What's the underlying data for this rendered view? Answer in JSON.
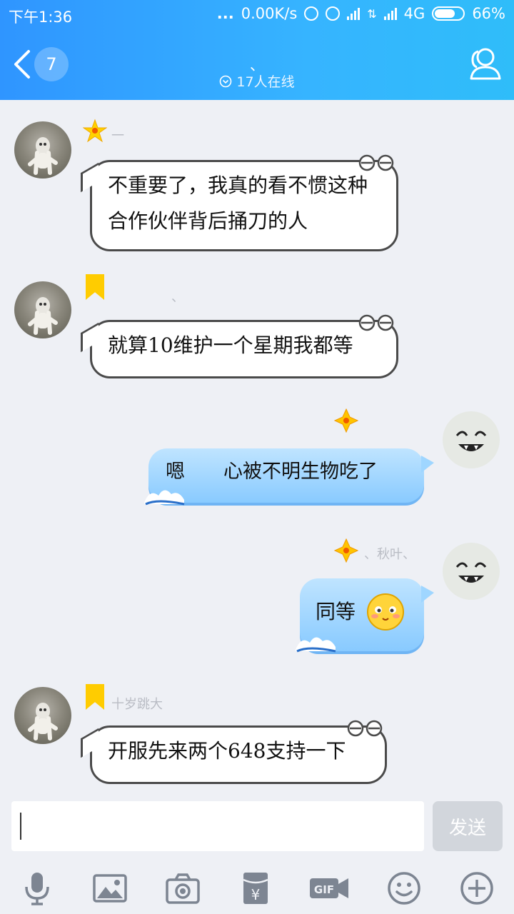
{
  "status_bar": {
    "time": "下午1:36",
    "dots": "...",
    "speed": "0.00K/s",
    "network": "4G",
    "battery": "66%"
  },
  "header": {
    "back_badge": "7",
    "title": "、",
    "online": "17人在线"
  },
  "messages": [
    {
      "side": "left",
      "name": "一",
      "text": "不重要了，我真的看不惯这种合作伙伴背后捅刀的人"
    },
    {
      "side": "left",
      "name": "、",
      "text": "就算10维护一个星期我都等"
    },
    {
      "side": "right",
      "name": "",
      "text": "嗯　　心被不明生物吃了"
    },
    {
      "side": "right",
      "name": "、秋叶、",
      "text": "同等"
    },
    {
      "side": "left",
      "name": "十岁跳大",
      "text": "开服先来两个648支持一下"
    }
  ],
  "input": {
    "placeholder": "",
    "send_label": "发送"
  },
  "toolbar": {
    "items": [
      "mic-icon",
      "image-icon",
      "camera-icon",
      "red-packet-icon",
      "gif-icon",
      "emoji-icon",
      "plus-icon"
    ]
  },
  "colors": {
    "header_start": "#2f95ff",
    "header_end": "#2fbdf9",
    "background": "#eef0f5",
    "send_disabled": "#d2d6dc",
    "bubble_border": "#4a4a4a"
  }
}
